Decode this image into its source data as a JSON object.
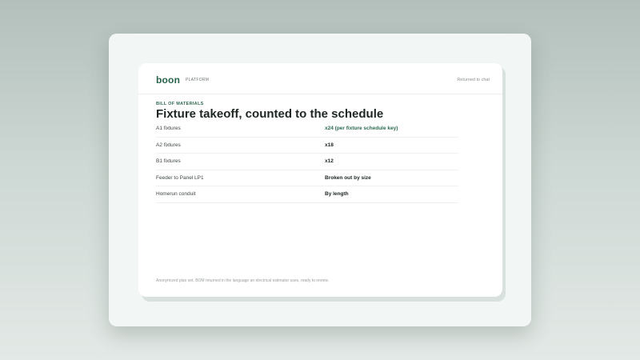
{
  "header": {
    "brand": "boon",
    "section": "PLATFORM",
    "status": "Returned to chat"
  },
  "main": {
    "eyebrow": "BILL OF MATERIALS",
    "title": "Fixture takeoff, counted to the schedule",
    "rows": [
      {
        "label": "A1 fixtures",
        "value": "x24  (per fixture schedule key)"
      },
      {
        "label": "A2 fixtures",
        "value": "x18"
      },
      {
        "label": "B1 fixtures",
        "value": "x12"
      },
      {
        "label": "Feeder to Panel LP1",
        "value": "Broken out by size"
      },
      {
        "label": "Homerun conduit",
        "value": "By length"
      }
    ],
    "footnote": "Anonymized plan set. BOM returned in the language an electrical estimator uses, ready to review."
  },
  "colors": {
    "accent": "#2b6b4e",
    "card": "#ffffff",
    "frame": "#f2f6f4"
  }
}
